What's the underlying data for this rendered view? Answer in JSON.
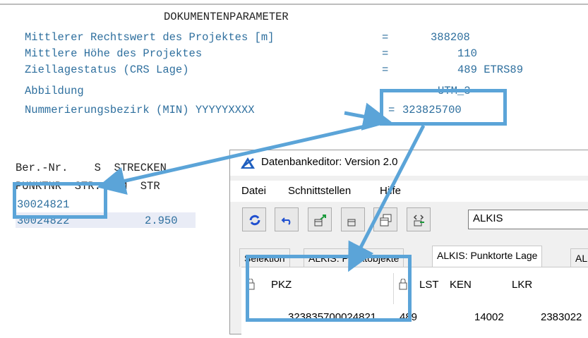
{
  "document": {
    "title": "DOKUMENTENPARAMETER",
    "params": [
      {
        "label": "Mittlerer Rechtswert des Projektes [m]",
        "eq": "=",
        "value": "388208"
      },
      {
        "label": "Mittlere Höhe des Projektes",
        "eq": "=",
        "value": "110"
      },
      {
        "label": "Ziellagestatus (CRS Lage)",
        "eq": "=",
        "value": "489 ETRS89"
      },
      {
        "label": "Abbildung",
        "eq": "",
        "value": "UTM_3"
      },
      {
        "label": "Nummerierungsbezirk (MIN) YYYYYXXXX",
        "eq": "=",
        "value": "323825700"
      }
    ],
    "table_header_1": "Ber.-Nr.    S  STRECKEN",
    "table_header_2": "PUNKTNR  STR.-GEM  STR",
    "rows": [
      {
        "nr": "30024821",
        "value": ""
      },
      {
        "nr": "30024822",
        "value": "2.950"
      }
    ]
  },
  "editor": {
    "title": "Datenbankeditor: Version 2.0",
    "menu": [
      "Datei",
      "Schnittstellen",
      "Hilfe"
    ],
    "combo_value": "ALKIS",
    "tabs": [
      "Selektion",
      "ALKIS: Punktobjekte",
      "ALKIS: Punktorte Lage",
      "AL"
    ],
    "columns": [
      "PKZ",
      "LST",
      "KEN",
      "LKR"
    ],
    "row": {
      "pkz": "323835700024821",
      "lst": "489",
      "ken": "14002",
      "lkr": "2383022"
    }
  },
  "colors": {
    "highlight": "#5ba4d8",
    "text_blue": "#2e6f9e"
  }
}
